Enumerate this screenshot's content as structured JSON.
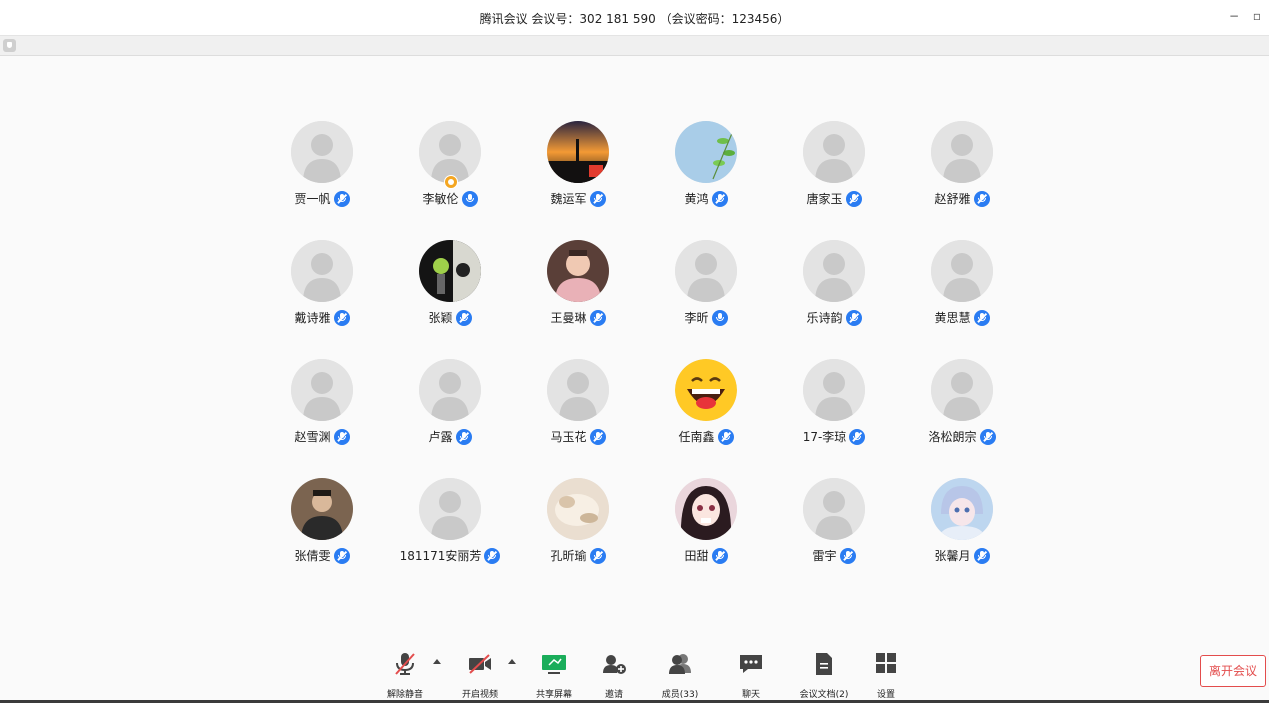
{
  "window": {
    "title": "腾讯会议 会议号：302 181 590 （会议密码：123456）",
    "minimize": "−",
    "restore": "▫"
  },
  "participants": [
    {
      "name": "贾一帆",
      "avatar": "default",
      "mic": "muted"
    },
    {
      "name": "李敏伦",
      "avatar": "default",
      "mic": "on",
      "host": true
    },
    {
      "name": "魏运军",
      "avatar": "sunset-photo",
      "mic": "muted"
    },
    {
      "name": "黄鸿",
      "avatar": "leaves-photo",
      "mic": "muted"
    },
    {
      "name": "唐家玉",
      "avatar": "default",
      "mic": "muted"
    },
    {
      "name": "赵舒雅",
      "avatar": "default",
      "mic": "muted"
    },
    {
      "name": "戴诗雅",
      "avatar": "default",
      "mic": "muted"
    },
    {
      "name": "张颖",
      "avatar": "bw-photo",
      "mic": "muted"
    },
    {
      "name": "王曼琳",
      "avatar": "girl-photo",
      "mic": "muted"
    },
    {
      "name": "李昕",
      "avatar": "default",
      "mic": "on"
    },
    {
      "name": "乐诗韵",
      "avatar": "default",
      "mic": "muted"
    },
    {
      "name": "黄思慧",
      "avatar": "default",
      "mic": "muted"
    },
    {
      "name": "赵雪渊",
      "avatar": "default",
      "mic": "muted"
    },
    {
      "name": "卢露",
      "avatar": "default",
      "mic": "muted"
    },
    {
      "name": "马玉花",
      "avatar": "default",
      "mic": "muted"
    },
    {
      "name": "任南鑫",
      "avatar": "laughing-emoji",
      "mic": "muted"
    },
    {
      "name": "17-李琼",
      "avatar": "default",
      "mic": "muted"
    },
    {
      "name": "洛松朗宗",
      "avatar": "default",
      "mic": "muted"
    },
    {
      "name": "张倩雯",
      "avatar": "boy-photo",
      "mic": "muted"
    },
    {
      "name": "181171安丽芳",
      "avatar": "default",
      "mic": "muted"
    },
    {
      "name": "孔昕瑜",
      "avatar": "cat-photo",
      "mic": "muted"
    },
    {
      "name": "田甜",
      "avatar": "anime-photo",
      "mic": "muted"
    },
    {
      "name": "雷宇",
      "avatar": "default",
      "mic": "muted"
    },
    {
      "name": "张馨月",
      "avatar": "anime-boy-photo",
      "mic": "muted"
    }
  ],
  "toolbar": {
    "unmute": "解除静音",
    "start_video": "开启视频",
    "share_screen": "共享屏幕",
    "invite": "邀请",
    "members": "成员(33)",
    "chat": "聊天",
    "docs": "会议文档(2)",
    "settings": "设置"
  },
  "leave_button": "离开会议",
  "colors": {
    "mic_blue": "#2a7cf2",
    "leave_red": "#e34d4d",
    "share_green": "#1aad5a",
    "mute_red": "#e34d4d"
  }
}
